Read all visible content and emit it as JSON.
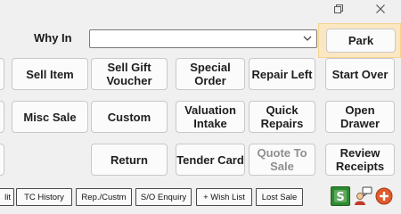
{
  "window": {
    "controls": [
      "restore-icon",
      "close-icon"
    ]
  },
  "why_in": {
    "label": "Why In",
    "value": ""
  },
  "buttons": {
    "park": "Park",
    "sell_item": "Sell Item",
    "sell_gift_voucher": "Sell Gift Voucher",
    "special_order": "Special Order",
    "repair_left": "Repair Left",
    "start_over": "Start Over",
    "misc_sale": "Misc Sale",
    "custom": "Custom",
    "valuation_intake": "Valuation Intake",
    "quick_repairs": "Quick Repairs",
    "open_drawer": "Open Drawer",
    "return": "Return",
    "tender_card": "Tender Card",
    "quote_to_sale": "Quote To Sale",
    "review_receipts": "Review Receipts"
  },
  "bottom_tabs": [
    "lit",
    "TC History",
    "Rep./Custm",
    "S/O Enquiry",
    "+ Wish List",
    "Lost Sale"
  ],
  "bottom_icons": [
    "s-icon",
    "customer-chat-icon",
    "add-icon"
  ],
  "colors": {
    "focus_highlight": "#fbe7c2",
    "s_icon_green": "#2e8b2e",
    "add_icon_red": "#e05a2b"
  }
}
